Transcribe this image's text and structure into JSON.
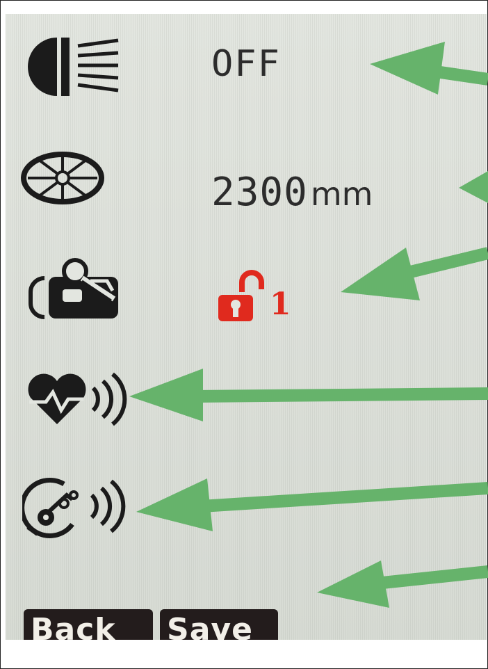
{
  "settings": {
    "headlight": {
      "icon": "headlight-icon",
      "value": "OFF"
    },
    "wheel": {
      "icon": "wheel-icon",
      "number": "2300",
      "unit": "mm"
    },
    "lock": {
      "icon": "lock-bike-icon",
      "state_icon": "unlocked-padlock-icon",
      "number": "1",
      "color": "#e02a1e"
    },
    "heart_rate_sensor": {
      "icon": "heart-rate-wireless-icon"
    },
    "cadence_sensor": {
      "icon": "cadence-wireless-icon"
    }
  },
  "softkeys": {
    "back_label": "Back",
    "save_label": "Save"
  },
  "annotation_color": "#66b36b"
}
